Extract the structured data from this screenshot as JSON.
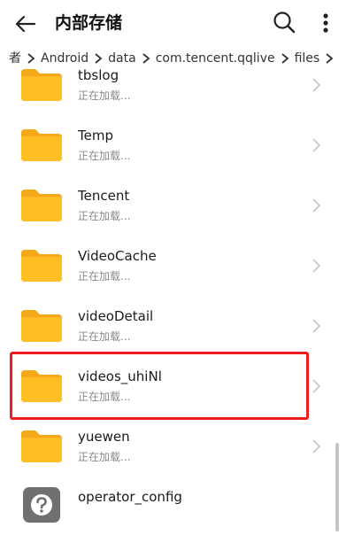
{
  "header": {
    "title": "内部存储"
  },
  "breadcrumb": [
    "者",
    "Android",
    "data",
    "com.tencent.qqlive",
    "files"
  ],
  "list": {
    "items": [
      {
        "name": "tbslog",
        "status": "正在加载..."
      },
      {
        "name": "Temp",
        "status": "正在加载..."
      },
      {
        "name": "Tencent",
        "status": "正在加载..."
      },
      {
        "name": "VideoCache",
        "status": "正在加载..."
      },
      {
        "name": "videoDetail",
        "status": "正在加载..."
      },
      {
        "name": "videos_uhiNl",
        "status": "正在加载..."
      },
      {
        "name": "yuewen",
        "status": "正在加载..."
      },
      {
        "name": "operator_config"
      }
    ]
  },
  "colors": {
    "folder": "#FFBF24",
    "folder_tab": "#F5A91A",
    "highlight": "#EE1C1C",
    "unknown_file_icon": "#707070"
  },
  "icons": {
    "back": "arrow-left-icon",
    "search": "search-icon",
    "more": "more-vertical-icon",
    "folder": "folder-icon",
    "unknown_file": "question-file-icon",
    "chevron": "chevron-right-icon"
  }
}
